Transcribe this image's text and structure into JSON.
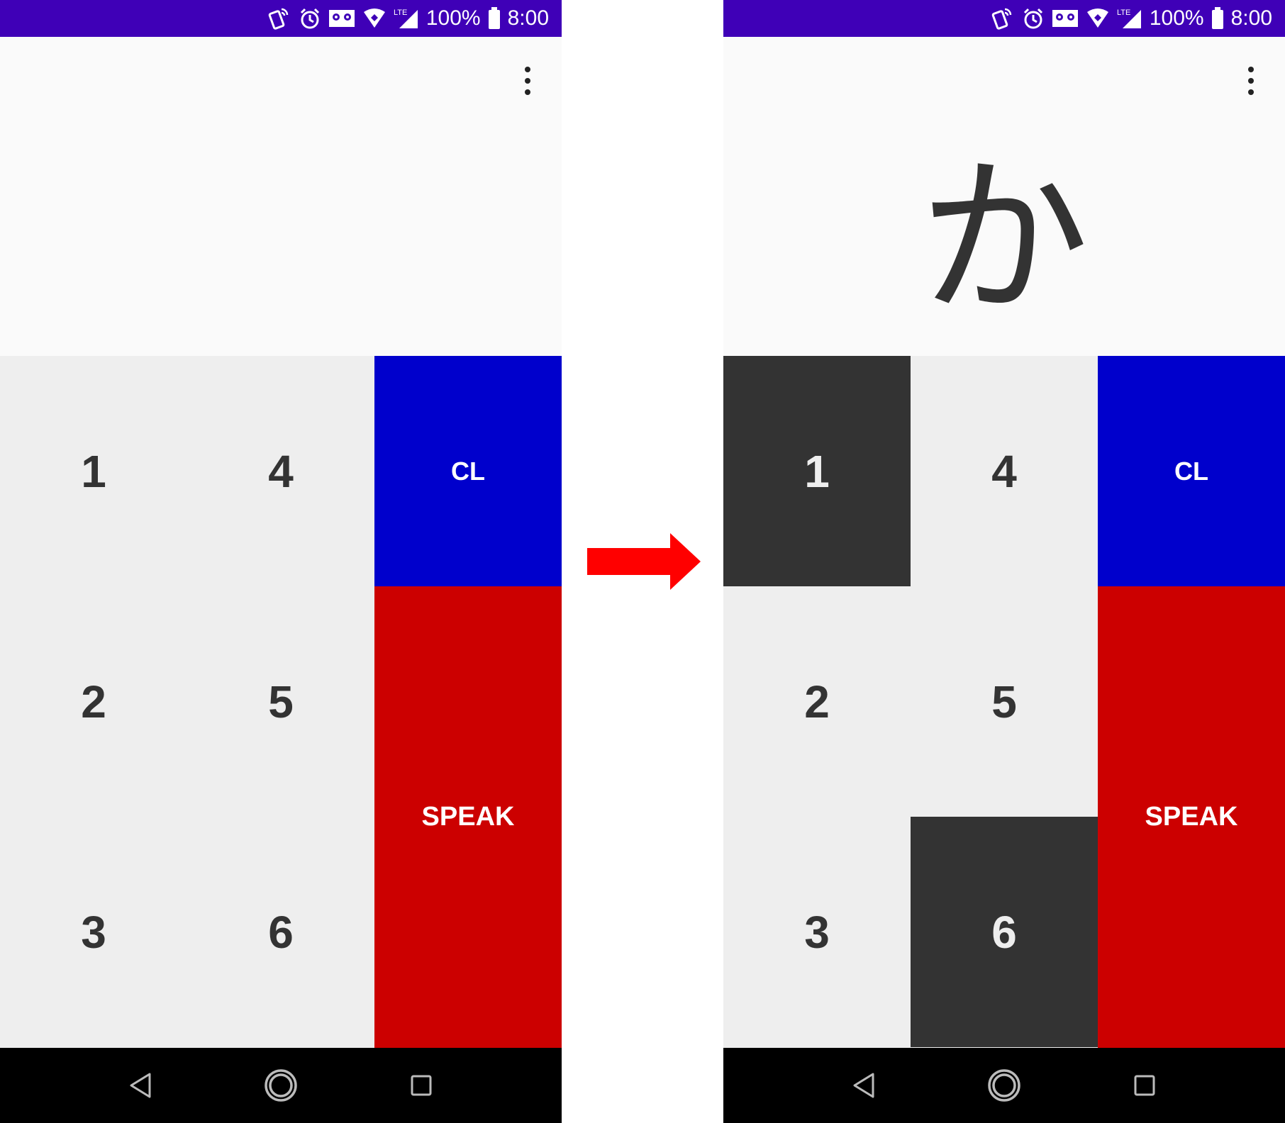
{
  "status_bar": {
    "battery_percent": "100%",
    "time": "8:00",
    "lte_label": "LTE",
    "background_color": "#3f00b7",
    "icons": [
      "vibrate-icon",
      "alarm-icon",
      "voicemail-icon",
      "wifi-icon",
      "lte-signal-icon",
      "battery-icon"
    ]
  },
  "keypad": {
    "keys": {
      "k1": "1",
      "k2": "2",
      "k3": "3",
      "k4": "4",
      "k5": "5",
      "k6": "6"
    },
    "clear_label": "CL",
    "speak_label": "SPEAK",
    "colors": {
      "keypad_bg": "#eeeeee",
      "active_key_bg": "#333333",
      "clear_bg": "#0000cc",
      "speak_bg": "#cc0000"
    }
  },
  "left_screen": {
    "display_char": "",
    "active_keys": []
  },
  "right_screen": {
    "display_char": "か",
    "active_keys": [
      "1",
      "6"
    ]
  },
  "transition_arrow": {
    "icon": "right-arrow-icon",
    "color": "#ff0000"
  },
  "nav_bar": {
    "icons": [
      "back-icon",
      "home-icon",
      "recents-icon"
    ]
  }
}
